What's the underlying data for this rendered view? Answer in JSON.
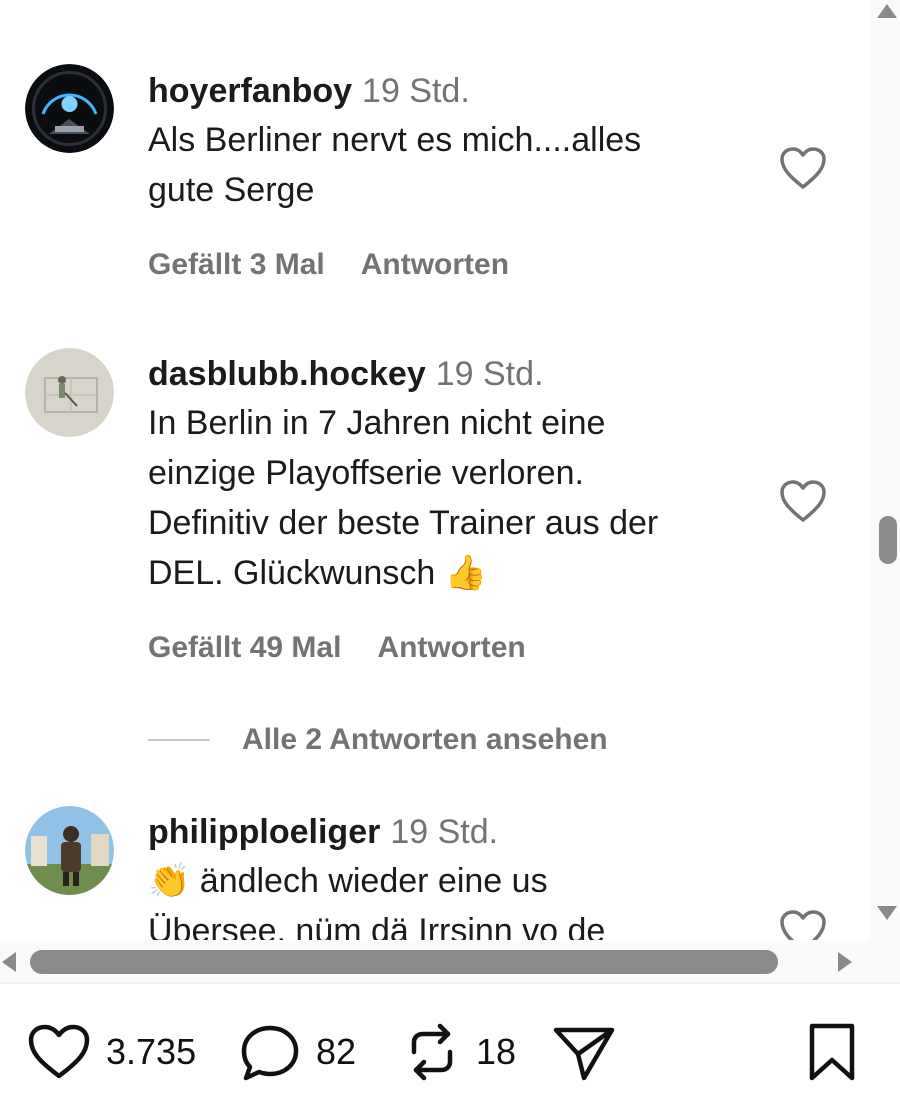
{
  "comments": [
    {
      "username": "hoyerfanboy",
      "time": "19 Std.",
      "lines": [
        "Als Berliner nervt es mich....alles",
        "gute Serge"
      ],
      "likes": "Gefällt 3 Mal",
      "reply": "Antworten"
    },
    {
      "username": "dasblubb.hockey",
      "time": "19 Std.",
      "lines": [
        "In Berlin in 7 Jahren nicht eine",
        "einzige Playoffserie verloren.",
        "Definitiv der beste Trainer aus der",
        "DEL. Glückwunsch 👍"
      ],
      "likes": "Gefällt 49 Mal",
      "reply": "Antworten",
      "view_replies": "Alle 2 Antworten ansehen"
    },
    {
      "username": "philipploeliger",
      "time": "19 Std.",
      "lines": [
        "👏 ändlech wieder eine us",
        "Übersee, nüm dä Irrsinn vo de"
      ]
    }
  ],
  "action_bar": {
    "likes": "3.735",
    "comments": "82",
    "reposts": "18"
  },
  "icons": {
    "like": "heart-icon",
    "comment": "speech-bubble-icon",
    "repost": "repost-icon",
    "share": "paper-plane-icon",
    "save": "bookmark-icon"
  }
}
